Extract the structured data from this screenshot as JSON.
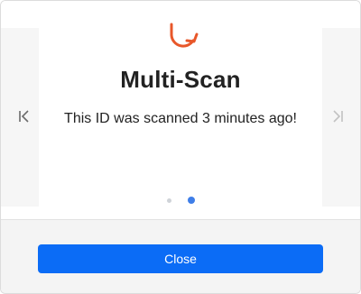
{
  "dialog": {
    "icon": "redo-arrow-icon",
    "title": "Multi-Scan",
    "message": "This ID was scanned 3 minutes ago!",
    "pagination": {
      "total": 2,
      "current": 2
    },
    "nav": {
      "prev_icon": "skip-back-icon",
      "next_icon": "skip-forward-icon"
    },
    "close_label": "Close"
  },
  "colors": {
    "accent_icon": "#e8572a",
    "primary_button": "#0b6cf6",
    "active_dot": "#3e7ee8",
    "inactive_dot": "#cfd3d8"
  }
}
